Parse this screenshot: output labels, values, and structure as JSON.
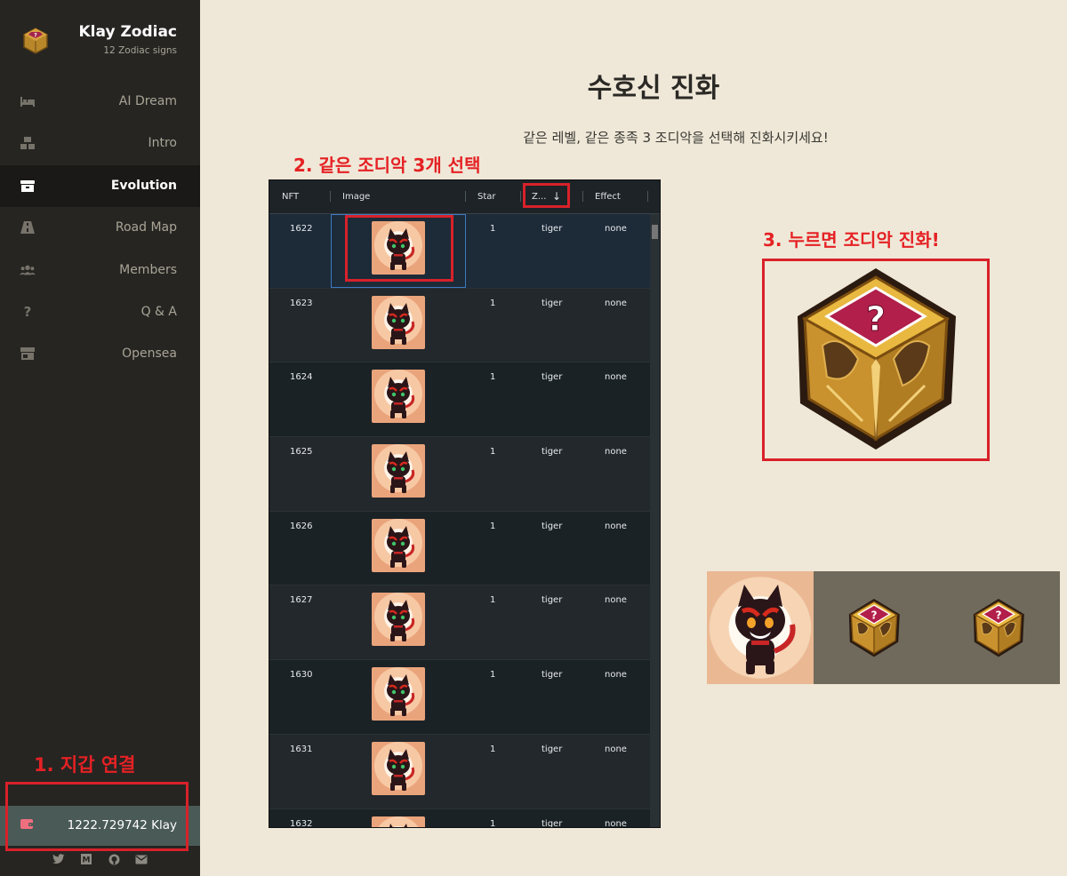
{
  "app": {
    "title": "Klay Zodiac",
    "subtitle": "12 Zodiac signs"
  },
  "sidebar": {
    "items": [
      {
        "label": "AI Dream",
        "icon": "bed-icon",
        "active": false
      },
      {
        "label": "Intro",
        "icon": "boxes-icon",
        "active": false
      },
      {
        "label": "Evolution",
        "icon": "box-icon",
        "active": true
      },
      {
        "label": "Road Map",
        "icon": "road-icon",
        "active": false
      },
      {
        "label": "Members",
        "icon": "users-icon",
        "active": false
      },
      {
        "label": "Q & A",
        "icon": "question-icon",
        "active": false
      },
      {
        "label": "Opensea",
        "icon": "store-icon",
        "active": false
      }
    ],
    "wallet": {
      "amount": "1222.729742 Klay",
      "icon": "wallet-icon"
    },
    "socials": [
      "twitter-icon",
      "medium-icon",
      "github-icon",
      "mail-icon"
    ]
  },
  "main": {
    "title": "수호신 진화",
    "subtitle": "같은 레벨, 같은 종족 3 조디악을 선택해 진화시키세요!"
  },
  "grid": {
    "columns": [
      "NFT",
      "Image",
      "Star",
      "Z...",
      "Effect"
    ],
    "sort_indicator": "↓",
    "rows": [
      {
        "nft": "1622",
        "star": "1",
        "zodiac": "tiger",
        "effect": "none",
        "selected": true
      },
      {
        "nft": "1623",
        "star": "1",
        "zodiac": "tiger",
        "effect": "none",
        "selected": false
      },
      {
        "nft": "1624",
        "star": "1",
        "zodiac": "tiger",
        "effect": "none",
        "selected": false
      },
      {
        "nft": "1625",
        "star": "1",
        "zodiac": "tiger",
        "effect": "none",
        "selected": false
      },
      {
        "nft": "1626",
        "star": "1",
        "zodiac": "tiger",
        "effect": "none",
        "selected": false
      },
      {
        "nft": "1627",
        "star": "1",
        "zodiac": "tiger",
        "effect": "none",
        "selected": false
      },
      {
        "nft": "1630",
        "star": "1",
        "zodiac": "tiger",
        "effect": "none",
        "selected": false
      },
      {
        "nft": "1631",
        "star": "1",
        "zodiac": "tiger",
        "effect": "none",
        "selected": false
      },
      {
        "nft": "1632",
        "star": "1",
        "zodiac": "tiger",
        "effect": "none",
        "selected": false
      }
    ]
  },
  "annotations": {
    "step1": "1. 지갑 연결",
    "step2": "2. 같은 조디악 3개 선택",
    "step3": "3. 누르면 조디악 진화!"
  },
  "colors": {
    "sidebar_bg": "#262522",
    "page_bg": "#efe8d8",
    "annotation_red": "#d8212a",
    "grid_bg": "#1d2327"
  }
}
